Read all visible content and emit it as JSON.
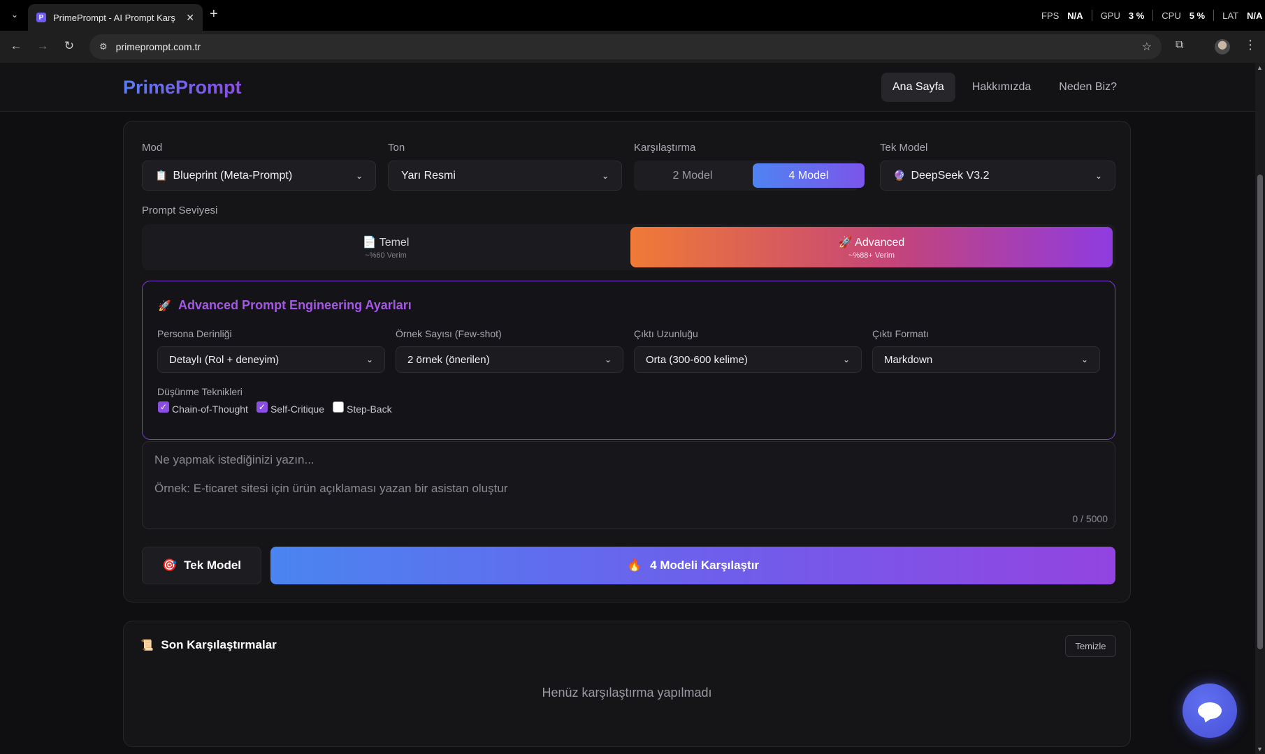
{
  "browser": {
    "tab_title": "PrimePrompt - AI Prompt Karşılaştırma",
    "favicon_letter": "P",
    "url": "primeprompt.com.tr",
    "perf": {
      "fps_label": "FPS",
      "fps_value": "N/A",
      "gpu_label": "GPU",
      "gpu_value": "3 %",
      "cpu_label": "CPU",
      "cpu_value": "5 %",
      "lat_label": "LAT",
      "lat_value": "N/A"
    }
  },
  "header": {
    "logo": "PrimePrompt",
    "nav": [
      "Ana Sayfa",
      "Hakkımızda",
      "Neden Biz?"
    ]
  },
  "form": {
    "mod": {
      "label": "Mod",
      "emoji": "📋",
      "value": "Blueprint (Meta-Prompt)"
    },
    "ton": {
      "label": "Ton",
      "value": "Yarı Resmi"
    },
    "compare": {
      "label": "Karşılaştırma",
      "options": [
        "2 Model",
        "4 Model"
      ],
      "selected": "4 Model"
    },
    "single_model": {
      "label": "Tek Model",
      "emoji": "🔮",
      "value": "DeepSeek V3.2"
    },
    "level": {
      "label": "Prompt Seviyesi",
      "basic": {
        "emoji": "📄",
        "title": "Temel",
        "sub": "~%60 Verim"
      },
      "advanced": {
        "emoji": "🚀",
        "title": "Advanced",
        "sub": "~%88+ Verim"
      },
      "selected": "Advanced"
    },
    "advanced_settings": {
      "emoji": "🚀",
      "title": "Advanced Prompt Engineering Ayarları",
      "persona": {
        "label": "Persona Derinliği",
        "value": "Detaylı (Rol + deneyim)"
      },
      "fewshot": {
        "label": "Örnek Sayısı (Few-shot)",
        "value": "2 örnek (önerilen)"
      },
      "length": {
        "label": "Çıktı Uzunluğu",
        "value": "Orta (300-600 kelime)"
      },
      "format": {
        "label": "Çıktı Formatı",
        "value": "Markdown"
      },
      "thinking": {
        "label": "Düşünme Teknikleri",
        "options": [
          {
            "label": "Chain-of-Thought",
            "checked": true
          },
          {
            "label": "Self-Critique",
            "checked": true
          },
          {
            "label": "Step-Back",
            "checked": false
          }
        ]
      }
    },
    "textarea": {
      "placeholder_line1": "Ne yapmak istediğinizi yazın...",
      "placeholder_line2": "Örnek: E-ticaret sitesi için ürün açıklaması yazan bir asistan oluştur",
      "counter": "0 / 5000"
    },
    "buttons": {
      "single": {
        "emoji": "🎯",
        "label": "Tek Model"
      },
      "compare": {
        "emoji": "🔥",
        "label": "4 Modeli Karşılaştır"
      }
    }
  },
  "recent": {
    "emoji": "📜",
    "title": "Son Karşılaştırmalar",
    "clear_label": "Temizle",
    "empty_text": "Henüz karşılaştırma yapılmadı"
  }
}
